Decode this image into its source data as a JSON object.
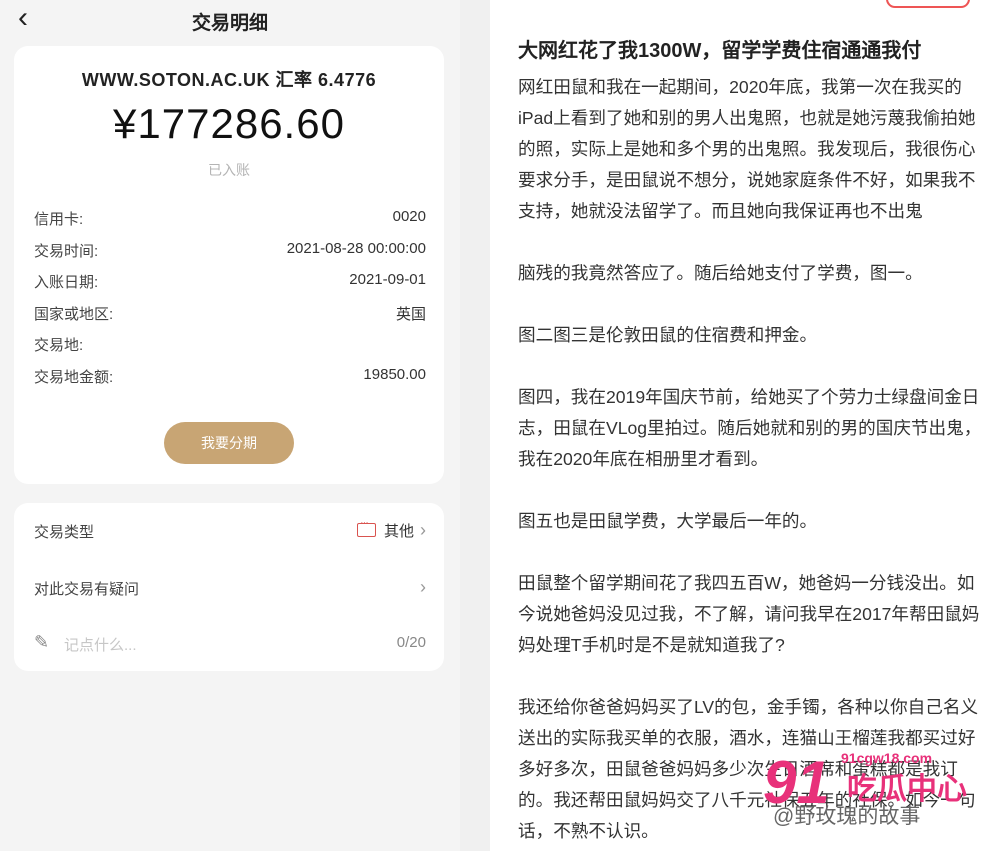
{
  "nav": {
    "back_icon": "chevron-left-icon",
    "title": "交易明细"
  },
  "card": {
    "merchant": "WWW.SOTON.AC.UK 汇率 6.4776",
    "amount": "¥177286.60",
    "status": "已入账",
    "rows": [
      {
        "label": "信用卡:",
        "value": "0020"
      },
      {
        "label": "交易时间:",
        "value": "2021-08-28 00:00:00"
      },
      {
        "label": "入账日期:",
        "value": "2021-09-01"
      },
      {
        "label": "国家或地区:",
        "value": "英国"
      },
      {
        "label": "交易地:",
        "value": ""
      },
      {
        "label": "交易地金额:",
        "value": "19850.00"
      }
    ],
    "installment_button": "我要分期"
  },
  "card2": {
    "type_label": "交易类型",
    "type_value": "其他",
    "dispute_label": "对此交易有疑问",
    "note_placeholder": "记点什么...",
    "note_count": "0/20",
    "chevron": "›"
  },
  "article": {
    "title": "大网红花了我1300W，留学学费住宿通通我付",
    "paragraphs": [
      "网红田鼠和我在一起期间，2020年底，我第一次在我买的iPad上看到了她和别的男人出鬼照，也就是她污蔑我偷拍她的照，实际上是她和多个男的出鬼照。我发现后，我很伤心要求分手，是田鼠说不想分，说她家庭条件不好，如果我不支持，她就没法留学了。而且她向我保证再也不出鬼",
      "脑残的我竟然答应了。随后给她支付了学费，图一。",
      "图二图三是伦敦田鼠的住宿费和押金。",
      "图四，我在2019年国庆节前，给她买了个劳力士绿盘间金日志，田鼠在VLog里拍过。随后她就和别的男的国庆节出鬼，我在2020年底在相册里才看到。",
      "图五也是田鼠学费，大学最后一年的。",
      "田鼠整个留学期间花了我四五百W，她爸妈一分钱没出。如今说她爸妈没见过我，不了解，请问我早在2017年帮田鼠妈妈处理T手机时是不是就知道我了?",
      "我还给你爸爸妈妈买了LV的包，金手镯，各种以你自己名义送出的实际我买单的衣服，酒水，连猫山王榴莲我都买过好多好多次，田鼠爸爸妈妈多少次生日酒席和蛋糕都是我订的。我还帮田鼠妈妈交了八千元社保五年的社保。如今一句话，不熟不认识。"
    ]
  },
  "watermark": {
    "big": "91",
    "url": "91cgw18.com",
    "cn": "吃瓜中心",
    "source": "@野玫瑰的故事"
  }
}
